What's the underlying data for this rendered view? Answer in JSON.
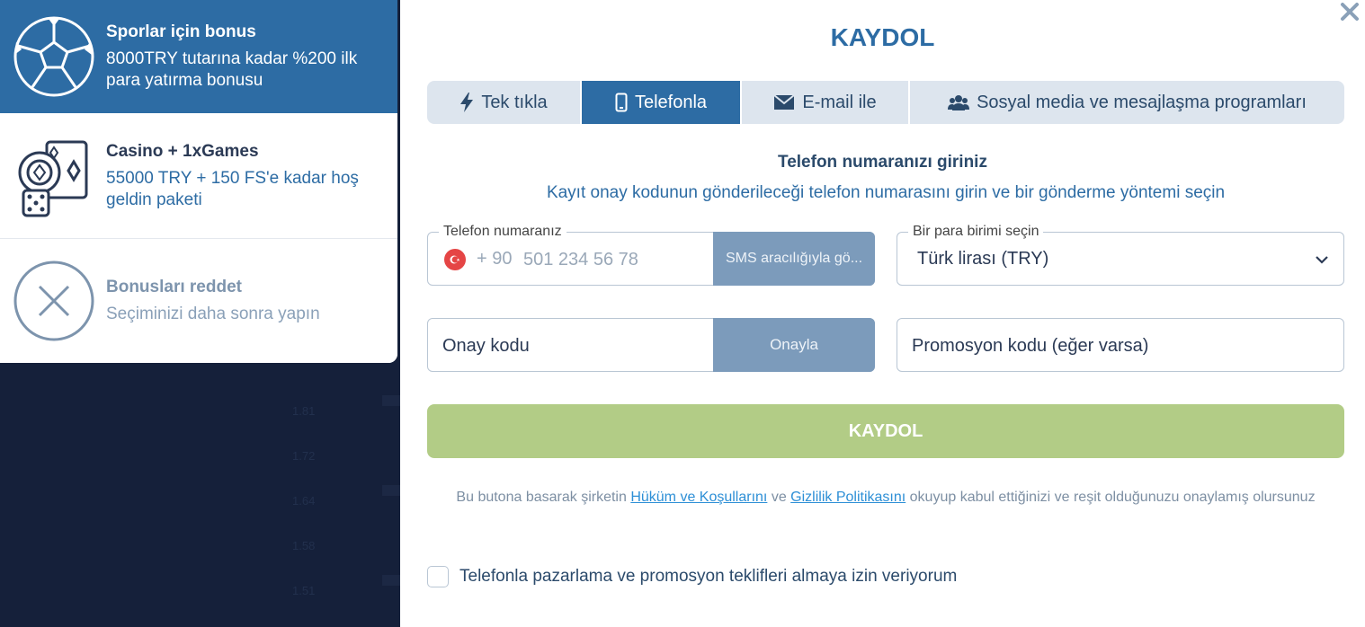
{
  "bonuses": {
    "sport": {
      "title": "Sporlar için bonus",
      "description": "8000TRY tutarına kadar %200 ilk para yatırma bonusu",
      "icon": "soccer-ball-icon"
    },
    "casino": {
      "title": "Casino + 1xGames",
      "description": "55000 TRY + 150 FS'e kadar hoş geldin paketi",
      "icon": "casino-chips-cards-icon"
    },
    "reject": {
      "title": "Bonusları reddet",
      "description": "Seçiminizi daha sonra yapın",
      "icon": "close-circle-icon"
    }
  },
  "modal": {
    "title": "KAYDOL",
    "tabs": [
      {
        "label": "Tek tıkla",
        "icon": "lightning-icon",
        "active": false
      },
      {
        "label": "Telefonla",
        "icon": "phone-icon",
        "active": true
      },
      {
        "label": "E-mail ile",
        "icon": "envelope-icon",
        "active": false
      },
      {
        "label": "Sosyal media ve mesajlaşma programları",
        "icon": "users-icon",
        "active": false
      }
    ],
    "subtitle": "Telefon numaranızı giriniz",
    "subtext": "Kayıt onay kodunun gönderileceği telefon numarasını girin ve bir gönderme yöntemi seçin",
    "phone": {
      "legend": "Telefon numaranız",
      "prefix": "+ 90",
      "placeholder": "501 234 56 78",
      "send_button": "SMS aracılığıyla gö..."
    },
    "currency": {
      "legend": "Bir para birimi seçin",
      "selected": "Türk lirası (TRY)"
    },
    "code": {
      "placeholder": "Onay kodu",
      "confirm_button": "Onayla"
    },
    "promo": {
      "placeholder": "Promosyon kodu (eğer varsa)"
    },
    "register_button": "KAYDOL",
    "terms": {
      "before": "Bu butona basarak şirketin ",
      "link1": "Hüküm ve Koşullarını",
      "middle": " ve ",
      "link2": "Gizlilik Politikasını",
      "after": " okuyup kabul ettiğinizi ve reşit olduğunuzu onaylamış olursunuz"
    },
    "consent_label": "Telefonla pazarlama ve promosyon teklifleri almaya izin veriyorum"
  },
  "colors": {
    "primary": "#2d6ca4",
    "register": "#b2cc86",
    "button_disabled": "#7c9bbb"
  }
}
